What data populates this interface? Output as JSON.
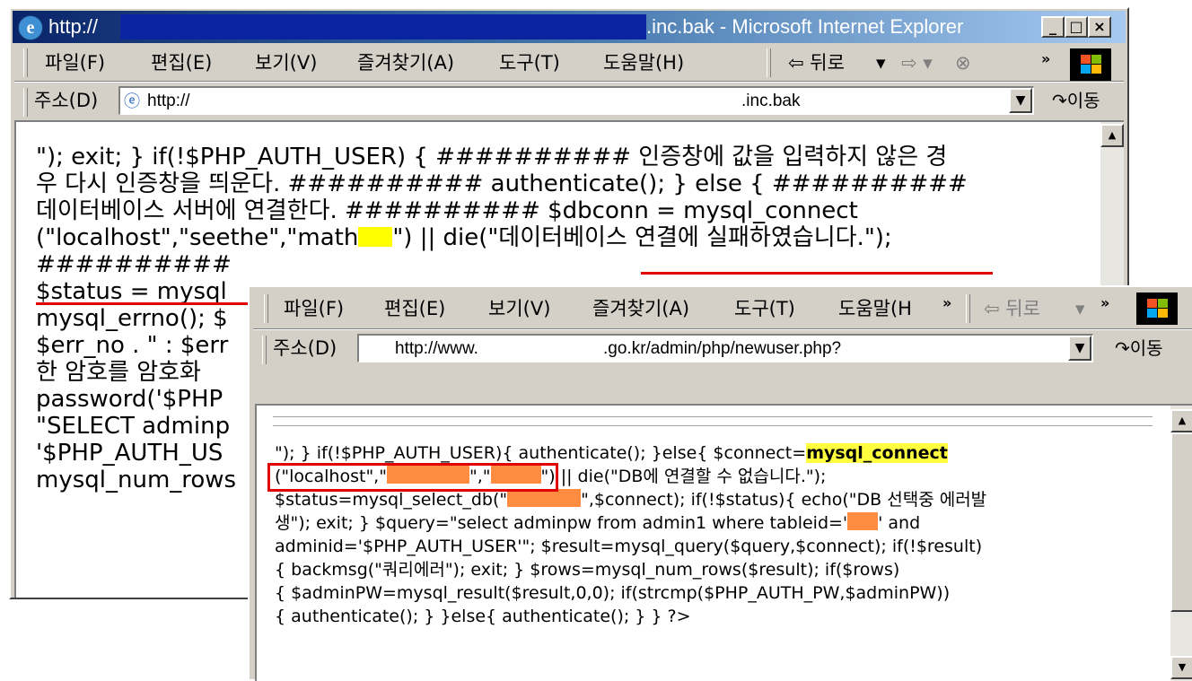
{
  "back_window": {
    "title_left": "http://",
    "title_right": ".inc.bak - Microsoft Internet Explorer",
    "menu": [
      "파일(F)",
      "편집(E)",
      "보기(V)",
      "즐겨찾기(A)",
      "도구(T)",
      "도움말(H)"
    ],
    "back_label": "⇦ 뒤로",
    "address_label": "주소(D)",
    "address_left": "http://",
    "address_right": ".inc.bak",
    "go_label": "이동",
    "content_lines": [
      "\"); exit; } if(!$PHP_AUTH_USER) { ########## 인증창에 값을 입력하지 않은 경",
      "우 다시 인증창을 띄운다. ########## authenticate(); } else { ##########",
      "데이터베이스 서버에 연결한다. ########## $dbconn = mysql_connect",
      "(\"localhost\",\"seethe\",\"math",
      "########## ",
      "$status = mysql_",
      "mysql_errno(); $",
      "$err_no . \" : $err",
      "한 암호를 암호화",
      "password('$PHP",
      "\"SELECT adminp",
      "'$PHP_AUTH_US",
      "mysql_num_rows"
    ],
    "line4_tail": "\") || die(\"데이터베이스 연결에 실패하였습니다.\");"
  },
  "front_window": {
    "menu": [
      "파일(F)",
      "편집(E)",
      "보기(V)",
      "즐겨찾기(A)",
      "도구(T)",
      "도움말(H"
    ],
    "chevron": "»",
    "back_label": "⇦ 뒤로",
    "address_label": "주소(D)",
    "address_left": "http://www.",
    "address_right": ".go.kr/admin/php/newuser.php?",
    "go_label": "이동",
    "line1_pre": "\"); } if(!$PHP_AUTH_USER){ authenticate(); }else{ $connect=",
    "line1_hl": "mysql_connect",
    "line2_a": "(\"localhost\",\"",
    "line2_b": "\",\"",
    "line2_c": "\")",
    "line2_d": " || die(\"DB에 연결할 수 없습니다.\");",
    "line3_a": "$status=mysql_select_db(\"",
    "line3_b": "\",$connect); if(!$status){ echo(\"DB 선택중 에러발",
    "line4_a": "생\"); exit; } $query=\"select adminpw from admin1 where tableid='",
    "line4_b": "' and",
    "lines_rest": [
      "adminid='$PHP_AUTH_USER'\"; $result=mysql_query($query,$connect); if(!$result)",
      "{ backmsg(\"쿼리에러\"); exit; } $rows=mysql_num_rows($result); if($rows)",
      "{ $adminPW=mysql_result($result,0,0); if(strcmp($PHP_AUTH_PW,$adminPW))",
      "{ authenticate(); } }else{ authenticate(); } } ?>"
    ]
  },
  "colors": {
    "redaction": "#ff8c40",
    "highlight": "#ffff40",
    "annotation": "#e00000",
    "title_bar": "#0a246a"
  }
}
